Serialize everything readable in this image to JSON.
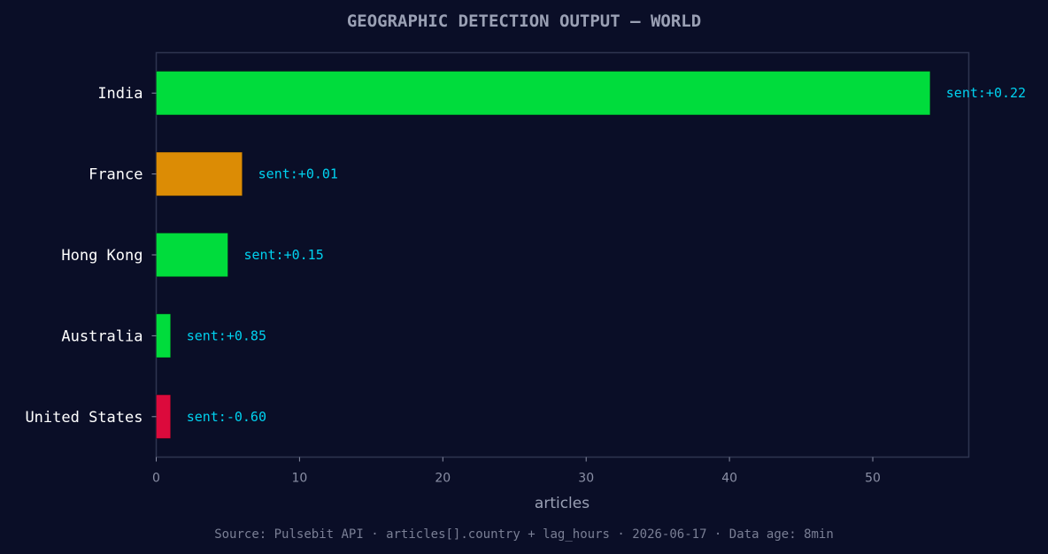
{
  "chart_data": {
    "type": "bar",
    "orientation": "horizontal",
    "title": "GEOGRAPHIC DETECTION OUTPUT — WORLD",
    "xlabel": "articles",
    "ylabel": "",
    "xlim": [
      0,
      56.7
    ],
    "x_ticks": [
      0,
      10,
      20,
      30,
      40,
      50
    ],
    "categories": [
      "India",
      "France",
      "Hong Kong",
      "Australia",
      "United States"
    ],
    "values": [
      54,
      6,
      5,
      1,
      1
    ],
    "sentiment_labels": [
      "sent:+0.22",
      "sent:+0.01",
      "sent:+0.15",
      "sent:+0.85",
      "sent:-0.60"
    ],
    "bar_colors": [
      "#00dc3c",
      "#dc8c05",
      "#00dc3c",
      "#00dc3c",
      "#dc0a3c"
    ],
    "grid": false,
    "legend": "none"
  },
  "footer": "Source: Pulsebit API · articles[].country + lag_hours · 2026-06-17 · Data age: 8min",
  "colors": {
    "background": "#0a0e27",
    "axes_frame": "#2e3450",
    "title": "#9aa0b4",
    "category_label": "#ffffff",
    "tick_label": "#8a8fa5",
    "annotation": "#00d2f0",
    "footer": "#7a7f95"
  }
}
